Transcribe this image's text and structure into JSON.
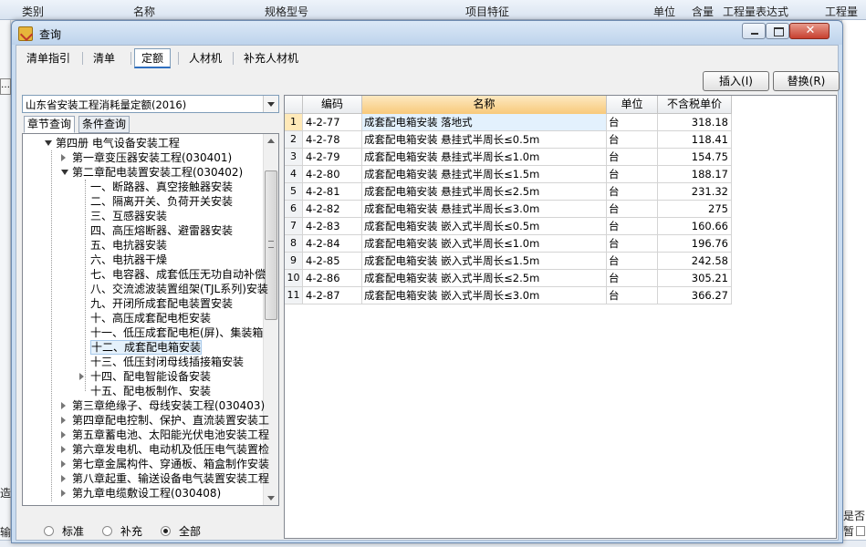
{
  "background_app": {
    "header_cols": [
      "类别",
      "名称",
      "规格型号",
      "项目特征",
      "单位",
      "含量",
      "工程量表达式",
      "工程量"
    ],
    "left_fragments": [
      "造",
      "输"
    ],
    "right_fragment": "是否暂"
  },
  "window": {
    "title": "查询"
  },
  "top_tabs": [
    {
      "label": "清单指引"
    },
    {
      "label": "清单"
    },
    {
      "label": "定额",
      "active": true
    },
    {
      "label": "人材机"
    },
    {
      "label": "补充人材机"
    }
  ],
  "actions": {
    "insert_label": "插入(I)",
    "replace_label": "替换(R)"
  },
  "quota_select": {
    "value": "山东省安装工程消耗量定额(2016)"
  },
  "sub_tabs": [
    {
      "label": "章节查询",
      "active": true
    },
    {
      "label": "条件查询"
    }
  ],
  "tree": [
    {
      "label": "第四册 电气设备安装工程",
      "level": 0,
      "state": "open"
    },
    {
      "label": "第一章变压器安装工程(030401)",
      "level": 1,
      "state": "closed"
    },
    {
      "label": "第二章配电装置安装工程(030402)",
      "level": 1,
      "state": "open"
    },
    {
      "label": "一、断路器、真空接触器安装",
      "level": 2,
      "state": "leaf"
    },
    {
      "label": "二、隔离开关、负荷开关安装",
      "level": 2,
      "state": "leaf"
    },
    {
      "label": "三、互感器安装",
      "level": 2,
      "state": "leaf"
    },
    {
      "label": "四、高压熔断器、避雷器安装",
      "level": 2,
      "state": "leaf"
    },
    {
      "label": "五、电抗器安装",
      "level": 2,
      "state": "leaf"
    },
    {
      "label": "六、电抗器干燥",
      "level": 2,
      "state": "leaf"
    },
    {
      "label": "七、电容器、成套低压无功自动补偿",
      "level": 2,
      "state": "leaf"
    },
    {
      "label": "八、交流滤波装置组架(TJL系列)安装",
      "level": 2,
      "state": "leaf"
    },
    {
      "label": "九、开闭所成套配电装置安装",
      "level": 2,
      "state": "leaf"
    },
    {
      "label": "十、高压成套配电柜安装",
      "level": 2,
      "state": "leaf"
    },
    {
      "label": "十一、低压成套配电柜(屏)、集装箱",
      "level": 2,
      "state": "leaf"
    },
    {
      "label": "十二、成套配电箱安装",
      "level": 2,
      "state": "leaf",
      "selected": true
    },
    {
      "label": "十三、低压封闭母线插接箱安装",
      "level": 2,
      "state": "leaf"
    },
    {
      "label": "十四、配电智能设备安装",
      "level": 2,
      "state": "closed"
    },
    {
      "label": "十五、配电板制作、安装",
      "level": 2,
      "state": "leaf"
    },
    {
      "label": "第三章绝缘子、母线安装工程(030403)",
      "level": 1,
      "state": "closed"
    },
    {
      "label": "第四章配电控制、保护、直流装置安装工",
      "level": 1,
      "state": "closed"
    },
    {
      "label": "第五章蓄电池、太阳能光伏电池安装工程",
      "level": 1,
      "state": "closed"
    },
    {
      "label": "第六章发电机、电动机及低压电气装置检",
      "level": 1,
      "state": "closed"
    },
    {
      "label": "第七章金属构件、穿通板、箱盒制作安装",
      "level": 1,
      "state": "closed"
    },
    {
      "label": "第八章起重、输送设备电气装置安装工程",
      "level": 1,
      "state": "closed"
    },
    {
      "label": "第九章电缆敷设工程(030408)",
      "level": 1,
      "state": "closed"
    }
  ],
  "scope_radios": [
    {
      "label": "标准",
      "checked": false
    },
    {
      "label": "补充",
      "checked": false
    },
    {
      "label": "全部",
      "checked": true
    }
  ],
  "grid": {
    "columns": [
      "",
      "编码",
      "名称",
      "单位",
      "不含税单价"
    ],
    "rows": [
      {
        "idx": "1",
        "code": "4-2-77",
        "name": "成套配电箱安装 落地式",
        "unit": "台",
        "price": "318.18",
        "selected": true
      },
      {
        "idx": "2",
        "code": "4-2-78",
        "name": "成套配电箱安装 悬挂式半周长≤0.5m",
        "unit": "台",
        "price": "118.41"
      },
      {
        "idx": "3",
        "code": "4-2-79",
        "name": "成套配电箱安装 悬挂式半周长≤1.0m",
        "unit": "台",
        "price": "154.75"
      },
      {
        "idx": "4",
        "code": "4-2-80",
        "name": "成套配电箱安装 悬挂式半周长≤1.5m",
        "unit": "台",
        "price": "188.17"
      },
      {
        "idx": "5",
        "code": "4-2-81",
        "name": "成套配电箱安装 悬挂式半周长≤2.5m",
        "unit": "台",
        "price": "231.32"
      },
      {
        "idx": "6",
        "code": "4-2-82",
        "name": "成套配电箱安装 悬挂式半周长≤3.0m",
        "unit": "台",
        "price": "275"
      },
      {
        "idx": "7",
        "code": "4-2-83",
        "name": "成套配电箱安装 嵌入式半周长≤0.5m",
        "unit": "台",
        "price": "160.66"
      },
      {
        "idx": "8",
        "code": "4-2-84",
        "name": "成套配电箱安装 嵌入式半周长≤1.0m",
        "unit": "台",
        "price": "196.76"
      },
      {
        "idx": "9",
        "code": "4-2-85",
        "name": "成套配电箱安装 嵌入式半周长≤1.5m",
        "unit": "台",
        "price": "242.58"
      },
      {
        "idx": "10",
        "code": "4-2-86",
        "name": "成套配电箱安装 嵌入式半周长≤2.5m",
        "unit": "台",
        "price": "305.21"
      },
      {
        "idx": "11",
        "code": "4-2-87",
        "name": "成套配电箱安装 嵌入式半周长≤3.0m",
        "unit": "台",
        "price": "366.27"
      }
    ]
  },
  "colors": {
    "accent": "#2f6fc0",
    "header_highlight": "#f8c97a",
    "selection": "#e3f1fd"
  }
}
